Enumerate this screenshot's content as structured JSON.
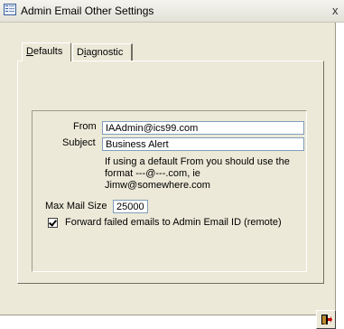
{
  "window": {
    "title": "Admin Email Other Settings",
    "close_glyph": "x"
  },
  "tabs": [
    {
      "label": "Defaults",
      "selected": true
    },
    {
      "label": "Diagnostic",
      "selected": false
    }
  ],
  "form": {
    "from_label": "From",
    "from_value": "IAAdmin@ics99.com",
    "subject_label": "Subject",
    "subject_value": "Business Alert",
    "hint_line1": "If using a default From you should use the",
    "hint_line2": "format ---@---.com, ie Jimw@somewhere.com",
    "max_mail_size_label": "Max Mail Size",
    "max_mail_size_value": "25000",
    "forward_checkbox_label": "Forward failed emails to Admin Email ID (remote)",
    "forward_checked": true
  },
  "footer": {
    "exit_icon": "exit-door-icon"
  }
}
